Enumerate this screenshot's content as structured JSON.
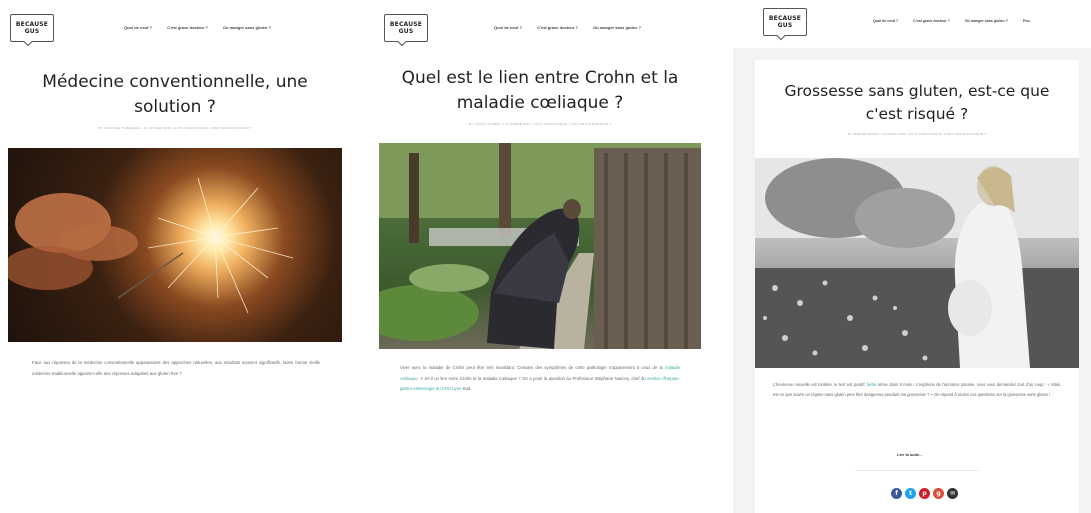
{
  "logo": {
    "line1": "BECAUSE",
    "line2": "GUS"
  },
  "nav": [
    "Quoi de neuf ?",
    "C'est grave docteur ?",
    "Où manger sans gluten ?",
    "Pou"
  ],
  "posts": [
    {
      "title": "Médecine conventionnelle, une solution ?",
      "meta": "BY CAROLINE THIBEDEAU  •  31 JANVIER 2015  •  ACTU SCIENTIFIQUE, C'EST GRAVE DOCTEUR ?",
      "excerpt": "Face aux réponses de la médecine conventionnelle apparaissent des approches naturelles, aux résultats souvent significatifs. Notre bonne vieille médecine traditionnelle apporte-t-elle des réponses adaptées aux gluten free ?"
    },
    {
      "title": "Quel est le lien entre Crohn et la maladie cœliaque ?",
      "meta": "BY CÉCILE OLIVER  •  2 OCTOBRE 2014  •  ACTU SCIENTIFIQUE, C'EST GRAVE DOCTEUR ?",
      "excerpt_a": "Vivre avec la maladie de Crohn peut être très invalidant. Certains des symptômes de cette pathologie s'apparentent à ceux de la ",
      "excerpt_link1": "maladie cœliaque",
      "excerpt_b": ". Y a-t-il un lien entre Crohn et la maladie cœliaque ? On a posé la question au Professeur Stéphane Nancey, chef du ",
      "excerpt_link2": "service d'hépato-gastro-entérologie du CHU Lyon",
      "excerpt_c": " Sud."
    },
    {
      "title": "Grossesse sans gluten, est-ce que c'est risqué ?",
      "meta": "BY MARINE PICKET  •  12 MARS 2015  •  ACTU SCIENTIFIQUE, C'EST GRAVE DOCTEUR ?",
      "excerpt_a": "L'heureuse nouvelle est tombée, le test est positif, ",
      "excerpt_link": "bébé",
      "excerpt_b": " arrive dans 9 mois ! L'euphorie de l'annonce passée, vous vous demandez tout d'un coup : « Mais, est-ce que suivre un régime sans gluten peut être dangereux pendant ma grossesse ? » On répond à toutes vos questions sur la grossesse sans gluten !",
      "read_more": "Lire la suite...",
      "share": [
        {
          "icon": "facebook-icon",
          "glyph": "f",
          "color": "#3b5998"
        },
        {
          "icon": "twitter-icon",
          "glyph": "t",
          "color": "#1da1f2"
        },
        {
          "icon": "pinterest-icon",
          "glyph": "p",
          "color": "#cb2027"
        },
        {
          "icon": "google-plus-icon",
          "glyph": "g",
          "color": "#dd4b39"
        },
        {
          "icon": "email-icon",
          "glyph": "✉",
          "color": "#333333"
        }
      ]
    }
  ]
}
